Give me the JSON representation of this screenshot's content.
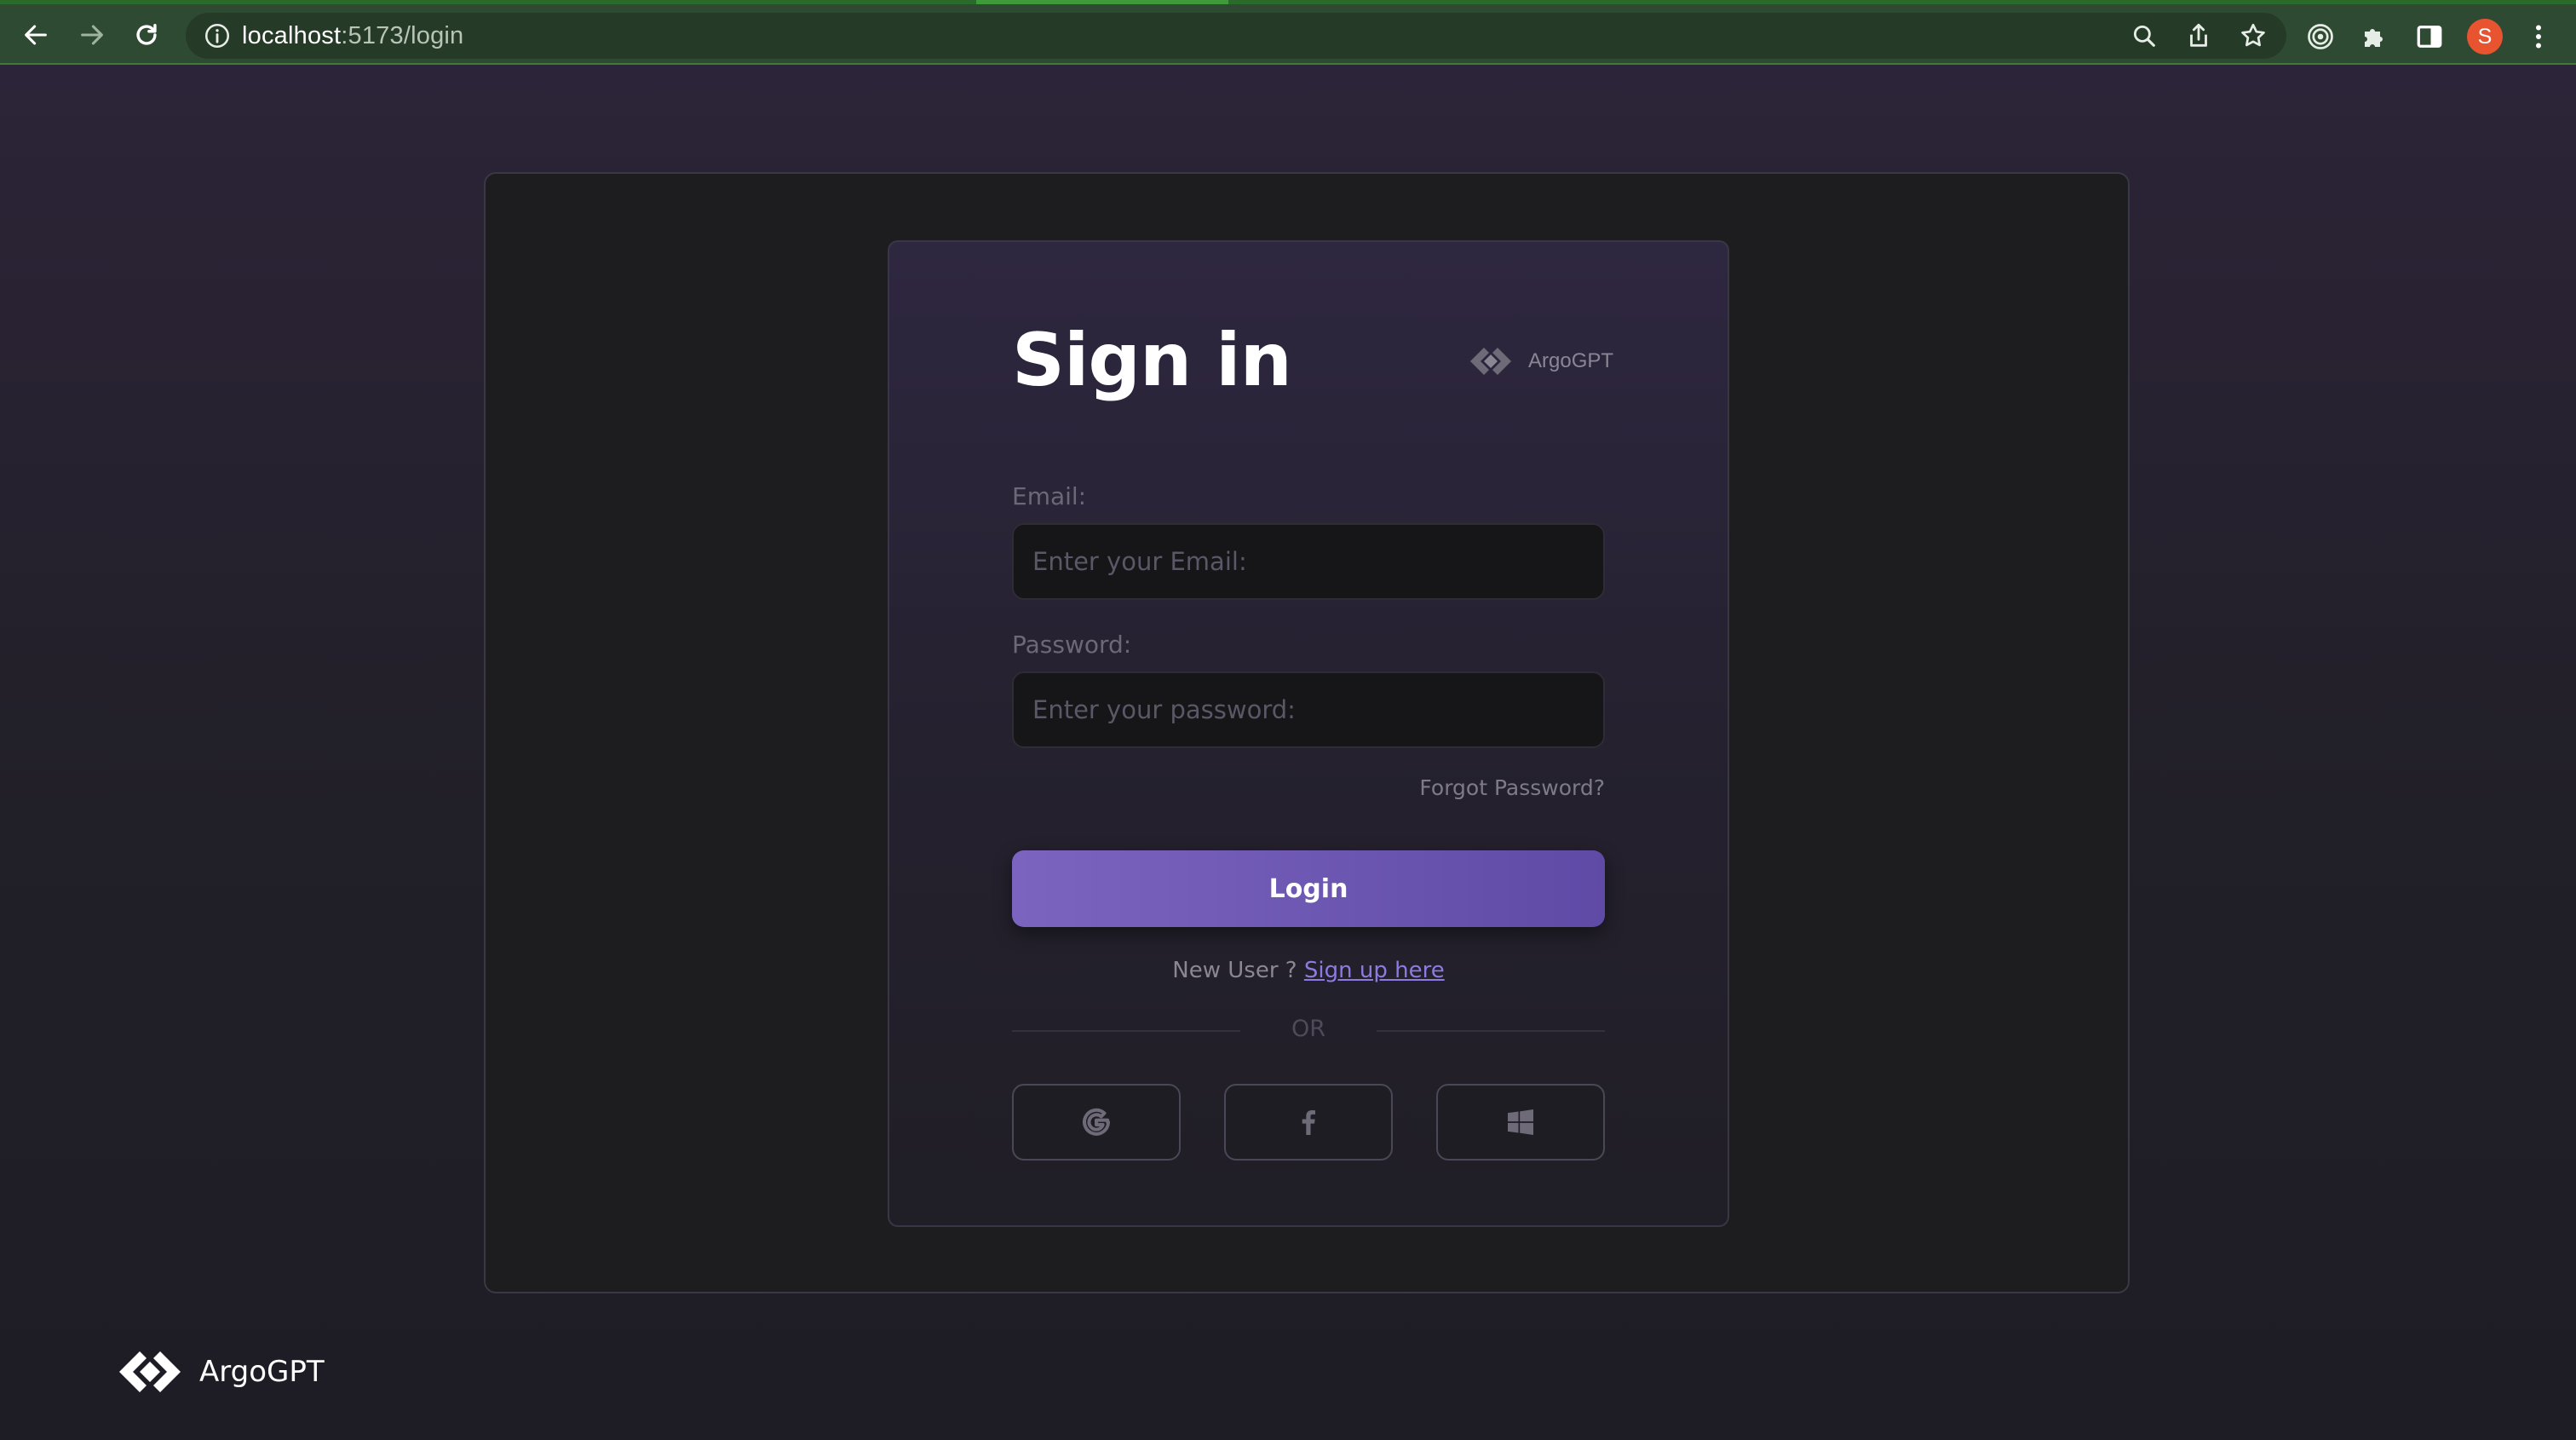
{
  "browser": {
    "url_host": "localhost",
    "url_path": ":5173/login",
    "profile_initial": "S",
    "icons": [
      "back-arrow-icon",
      "forward-arrow-icon",
      "reload-icon",
      "info-icon",
      "zoom-icon",
      "share-icon",
      "bookmark-star-icon",
      "extension-target-icon",
      "extensions-puzzle-icon",
      "side-panel-icon",
      "kebab-menu-icon"
    ]
  },
  "card": {
    "title": "Sign in",
    "brand_name": "ArgoGPT",
    "email_label": "Email:",
    "email_placeholder": "Enter your Email:",
    "password_label": "Password:",
    "password_placeholder": "Enter your password:",
    "forgot_label": "Forgot Password?",
    "login_label": "Login",
    "new_user_text": "New User ? ",
    "signup_link": "Sign up here",
    "or_label": "OR",
    "social": [
      "google-icon",
      "facebook-icon",
      "windows-icon"
    ]
  },
  "footer": {
    "brand_name": "ArgoGPT"
  },
  "colors": {
    "accent": "#7b64c0",
    "link": "#8e7ae0",
    "chrome": "#2f4a32",
    "avatar": "#e8542f"
  }
}
